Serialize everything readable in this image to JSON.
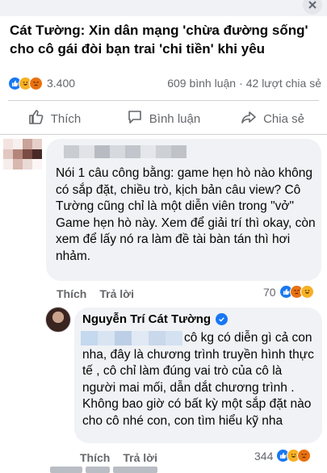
{
  "post": {
    "headline": "Cát Tường: Xin dân mạng 'chừa đường sống' cho cô gái đòi bạn trai 'chi tiền' khi yêu",
    "reaction_count": "3.400",
    "comments_text": "609 bình luận",
    "separator": "·",
    "shares_text": "42 lượt chia sẻ"
  },
  "actions": {
    "like": "Thích",
    "comment": "Bình luận",
    "share": "Chia sẻ"
  },
  "comment1": {
    "text": "Nói 1 câu công bằng: game hẹn hò nào không có sắp đặt, chiều trò, kịch bản câu view? Cô Tường cũng chỉ là một diễn viên trong \"vở\" Game hẹn hò này. Xem để giải trí thì okay, còn xem để lấy nó ra làm đề tài bàn tán thì hơi nhảm.",
    "like_label": "Thích",
    "reply_label": "Trả lời",
    "reaction_count": "70"
  },
  "comment2": {
    "author": "Nguyễn Trí Cát Tường",
    "text": "cô kg có diễn gì cả con nha, đây là chương trình truyền hình thực tế , cô chỉ làm đúng vai trò của cô là người mai mối, dẫn dắt chương trình . Không bao giờ có bất kỳ một sắp đặt nào cho cô nhé con, con tìm hiểu kỹ nha",
    "like_label": "Thích",
    "reply_label": "Trả lời",
    "reaction_count": "344"
  },
  "icons": {
    "corner": "close-icon",
    "like": "thumbs-up-icon",
    "comment": "speech-bubble-icon",
    "share": "share-arrow-icon",
    "verified": "verified-badge-icon"
  },
  "colors": {
    "facebook_blue": "#1877f2",
    "meta_text": "#65676b",
    "bubble_bg": "#f0f2f5"
  }
}
